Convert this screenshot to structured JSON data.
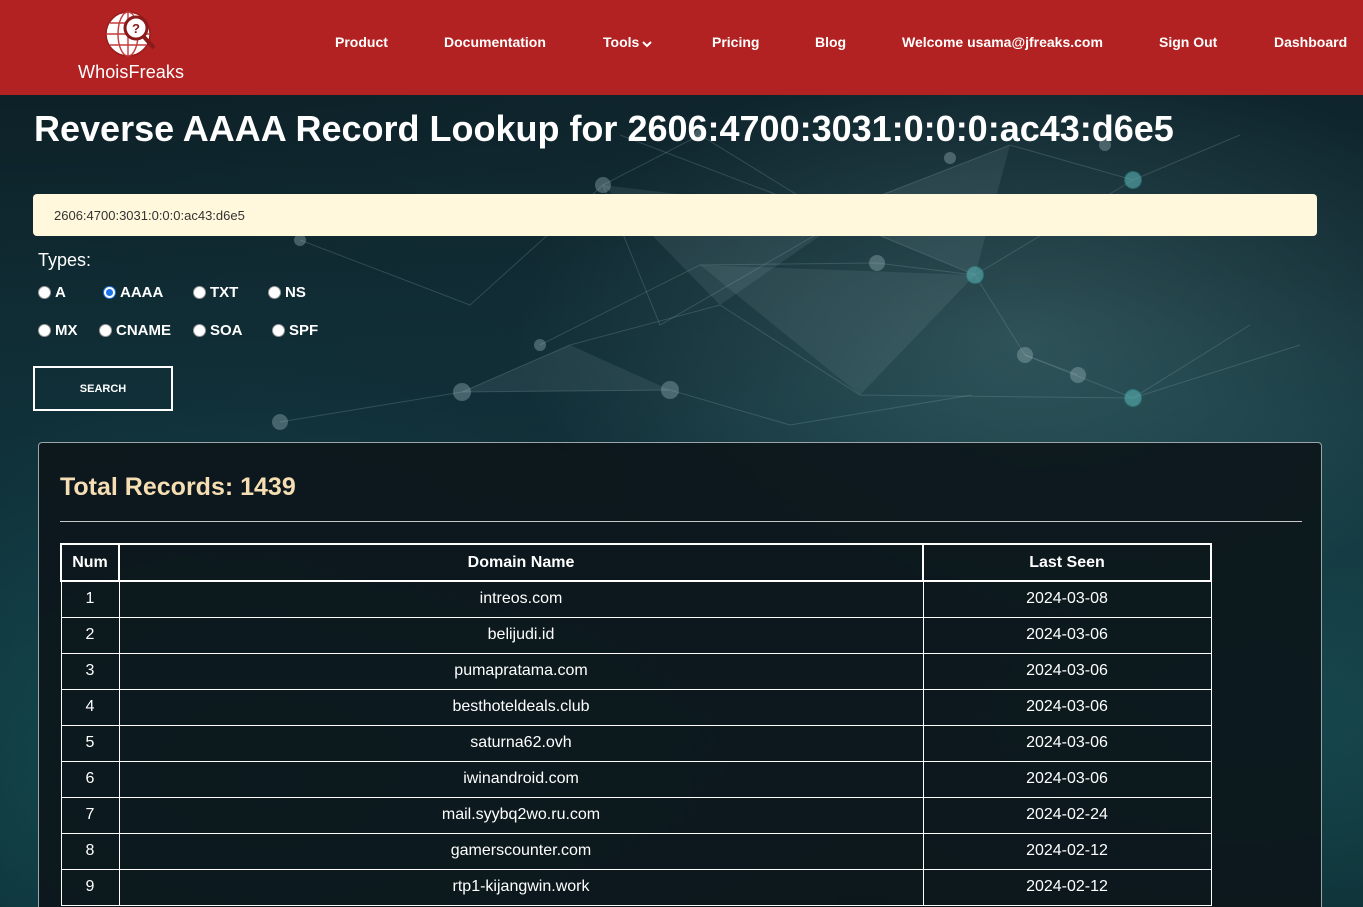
{
  "header": {
    "logo_text": "WhoisFreaks",
    "nav": [
      {
        "label": "Product"
      },
      {
        "label": "Documentation"
      },
      {
        "label": "Tools"
      },
      {
        "label": "Pricing"
      },
      {
        "label": "Blog"
      },
      {
        "label": "Welcome usama@jfreaks.com"
      },
      {
        "label": "Sign Out"
      },
      {
        "label": "Dashboard"
      }
    ]
  },
  "page": {
    "title": "Reverse AAAA Record Lookup for 2606:4700:3031:0:0:0:ac43:d6e5"
  },
  "search": {
    "value": "2606:4700:3031:0:0:0:ac43:d6e5",
    "types_label": "Types:",
    "types": [
      {
        "label": "A",
        "checked": false
      },
      {
        "label": "AAAA",
        "checked": true
      },
      {
        "label": "TXT",
        "checked": false
      },
      {
        "label": "NS",
        "checked": false
      },
      {
        "label": "MX",
        "checked": false
      },
      {
        "label": "CNAME",
        "checked": false
      },
      {
        "label": "SOA",
        "checked": false
      },
      {
        "label": "SPF",
        "checked": false
      }
    ],
    "button_label": "SEARCH"
  },
  "results": {
    "total_label": "Total Records: 1439",
    "columns": [
      "Num",
      "Domain Name",
      "Last Seen"
    ],
    "rows": [
      [
        "1",
        "intreos.com",
        "2024-03-08"
      ],
      [
        "2",
        "belijudi.id",
        "2024-03-06"
      ],
      [
        "3",
        "pumapratama.com",
        "2024-03-06"
      ],
      [
        "4",
        "besthoteldeals.club",
        "2024-03-06"
      ],
      [
        "5",
        "saturna62.ovh",
        "2024-03-06"
      ],
      [
        "6",
        "iwinandroid.com",
        "2024-03-06"
      ],
      [
        "7",
        "mail.syybq2wo.ru.com",
        "2024-02-24"
      ],
      [
        "8",
        "gamerscounter.com",
        "2024-02-12"
      ],
      [
        "9",
        "rtp1-kijangwin.work",
        "2024-02-12"
      ]
    ]
  },
  "colors": {
    "header_bg": "#b22222",
    "input_bg": "#fff8dc",
    "total_text": "#f5deb3",
    "radio_checked": "#1a73e8"
  }
}
